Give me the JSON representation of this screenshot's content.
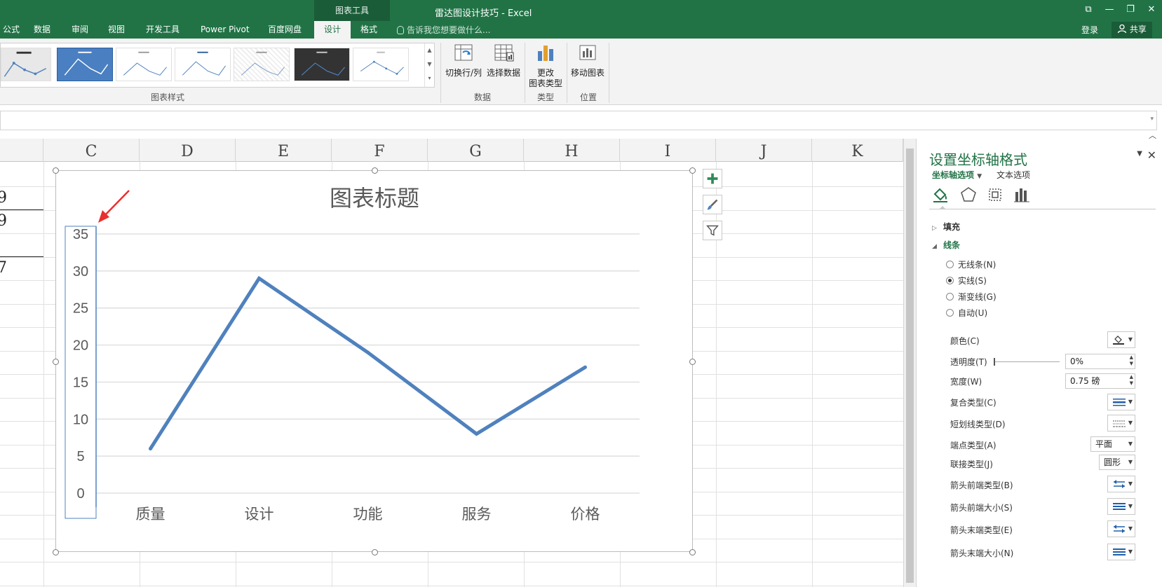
{
  "window": {
    "context_tab": "图表工具",
    "title": "雷达图设计技巧 - Excel",
    "restore_glyph": "⧉",
    "min_glyph": "—",
    "max_glyph": "❐",
    "close_glyph": "✕"
  },
  "tabs": [
    "公式",
    "数据",
    "审阅",
    "视图",
    "开发工具",
    "Power Pivot",
    "百度网盘",
    "设计",
    "格式"
  ],
  "active_tab": "设计",
  "tellme": "告诉我您想要做什么...",
  "signin": "登录",
  "share": "共享",
  "ribbon": {
    "group_styles": "图表样式",
    "switch_row_col": "切换行/列",
    "select_data": "选择数据",
    "group_data": "数据",
    "change_type_1": "更改",
    "change_type_2": "图表类型",
    "group_type": "类型",
    "move_chart": "移动图表",
    "group_location": "位置"
  },
  "sheet": {
    "columns": [
      "C",
      "D",
      "E",
      "F",
      "G",
      "H",
      "I",
      "J",
      "K"
    ],
    "partial_values": [
      "9",
      "9",
      "7"
    ]
  },
  "chart_data": {
    "type": "line",
    "title": "图表标题",
    "categories": [
      "质量",
      "设计",
      "功能",
      "服务",
      "价格"
    ],
    "series": [
      {
        "values": [
          6,
          29,
          19,
          8,
          17
        ]
      }
    ],
    "ylim": [
      0,
      35
    ],
    "yticks": [
      0,
      5,
      10,
      15,
      20,
      25,
      30,
      35
    ],
    "grid": true,
    "color": "#4f81bd"
  },
  "pane": {
    "title": "设置坐标轴格式",
    "sub_axis": "坐标轴选项",
    "sub_text": "文本选项",
    "fill": "填充",
    "line": "线条",
    "no_line": "无线条(N)",
    "solid_line": "实线(S)",
    "gradient_line": "渐变线(G)",
    "auto": "自动(U)",
    "color": "颜色(C)",
    "transparency": "透明度(T)",
    "transparency_value": "0%",
    "width": "宽度(W)",
    "width_value": "0.75 磅",
    "compound": "复合类型(C)",
    "dash": "短划线类型(D)",
    "cap": "端点类型(A)",
    "cap_value": "平面",
    "join": "联接类型(J)",
    "join_value": "圆形",
    "begin_arrow_type": "箭头前端类型(B)",
    "begin_arrow_size": "箭头前端大小(S)",
    "end_arrow_type": "箭头末端类型(E)",
    "end_arrow_size": "箭头末端大小(N)"
  }
}
